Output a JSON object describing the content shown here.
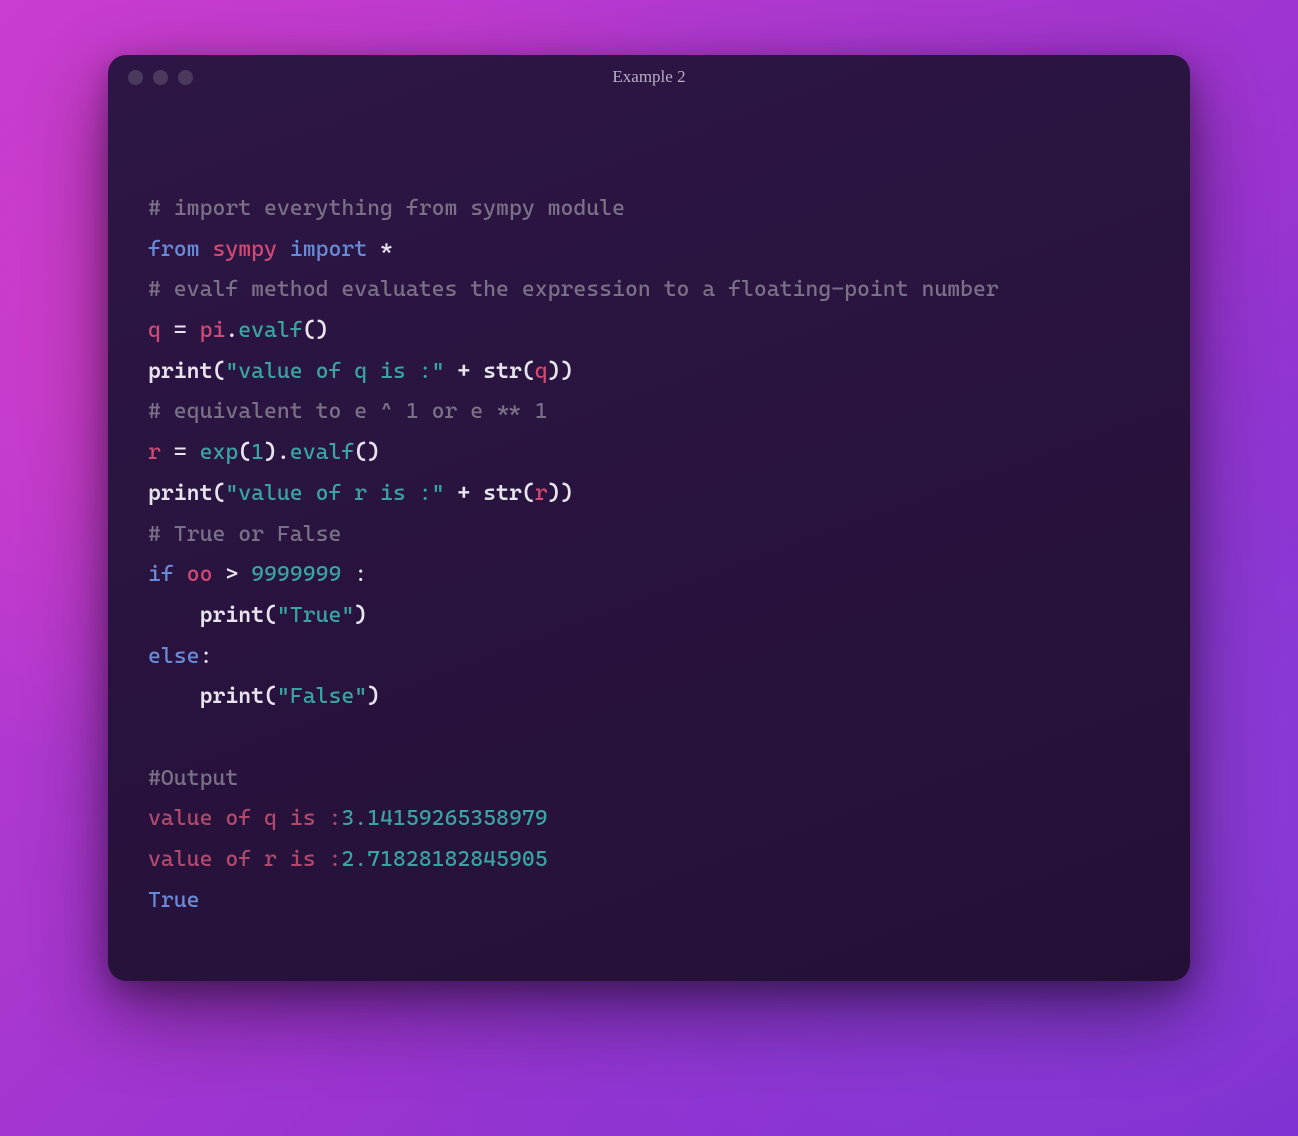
{
  "window": {
    "title": "Example 2"
  },
  "code": {
    "comment1": "# import everything from sympy module",
    "kw_from": "from",
    "module": "sympy",
    "kw_import": "import",
    "star": "*",
    "comment2": "# evalf method evaluates the expression to a floating-point number",
    "var_q": "q",
    "eq": " = ",
    "pi": "pi",
    "dot": ".",
    "evalf": "evalf",
    "parens": "()",
    "print": "print",
    "lparen": "(",
    "rparen": ")",
    "str_q": "\"value of q is :\"",
    "plus": " + ",
    "str_fn": "str",
    "q_ref": "q",
    "comment3": "# equivalent to e ^ 1 or e ** 1",
    "var_r": "r",
    "exp": "exp",
    "one": "1",
    "str_r": "\"value of r is :\"",
    "r_ref": "r",
    "comment4": "# True or False",
    "kw_if": "if",
    "oo": "oo",
    "gt": " > ",
    "bignum": "9999999",
    "colon": " :",
    "colon2": ":",
    "indent": "    ",
    "str_true": "\"True\"",
    "kw_else": "else",
    "str_false": "\"False\"",
    "comment_output": "#Output",
    "out_q_label": "value of q is :",
    "out_q_val": "3.14159265358979",
    "out_r_label": "value of r is :",
    "out_r_val": "2.71828182845905",
    "out_true": "True"
  }
}
